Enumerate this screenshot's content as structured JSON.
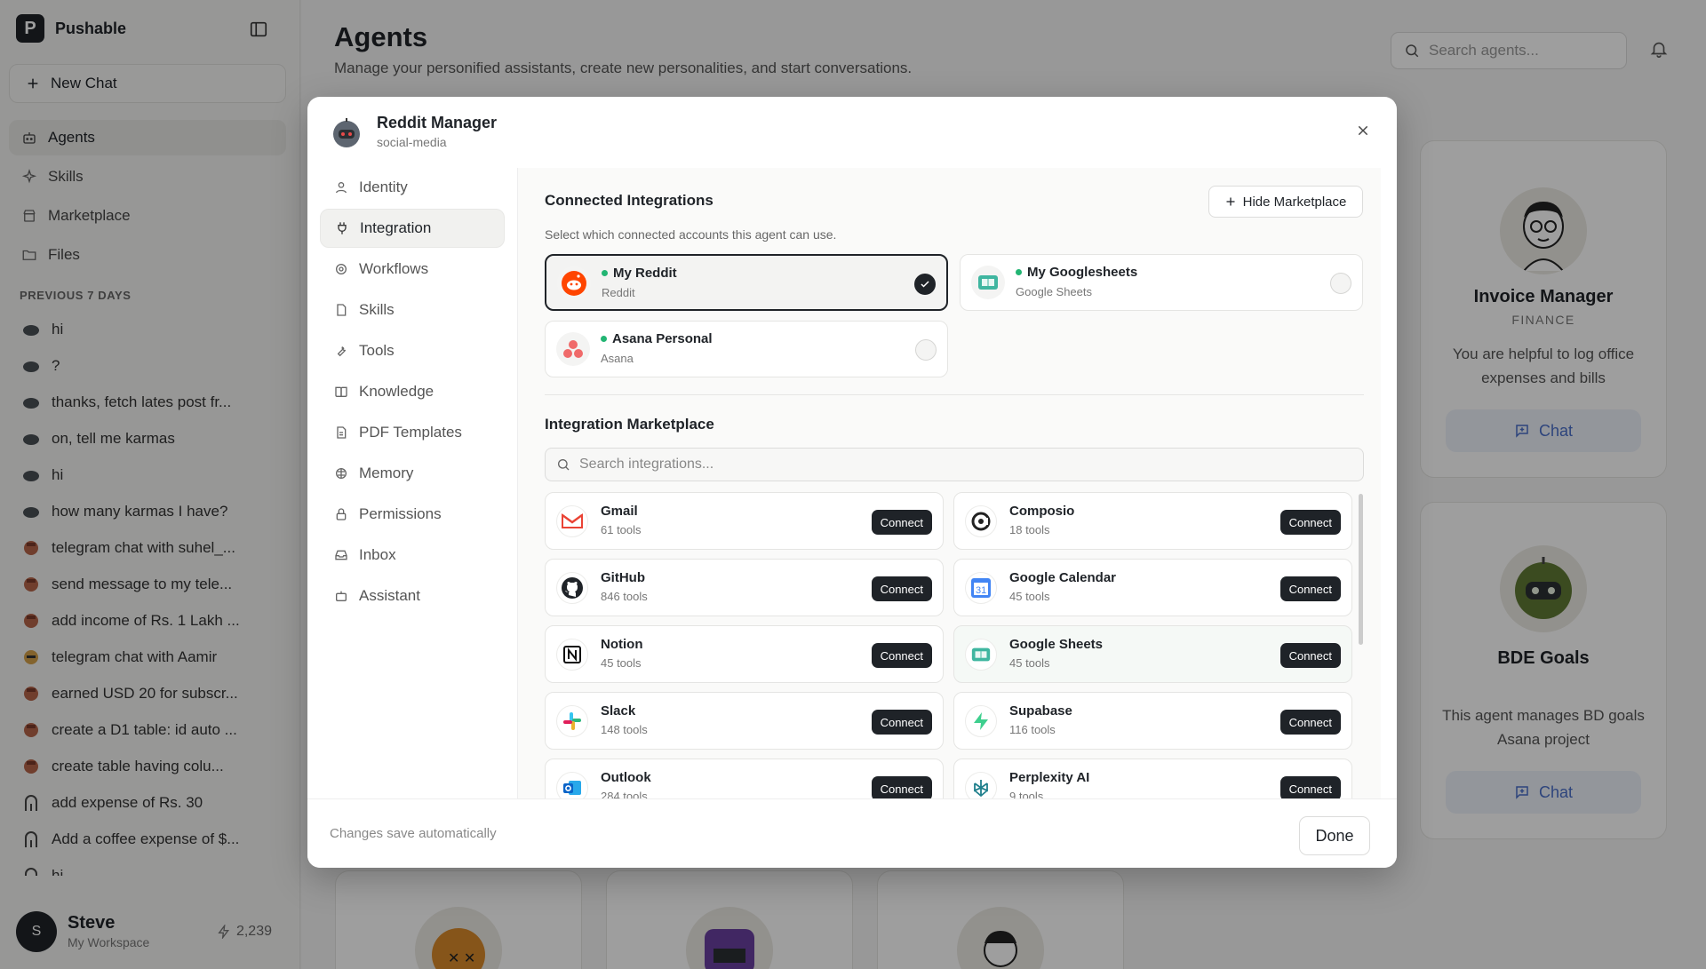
{
  "app": {
    "name": "Pushable"
  },
  "sidebar": {
    "new_chat": "New Chat",
    "nav": [
      {
        "label": "Agents",
        "icon": "bot-icon"
      },
      {
        "label": "Skills",
        "icon": "sparkles-icon"
      },
      {
        "label": "Marketplace",
        "icon": "store-icon"
      },
      {
        "label": "Files",
        "icon": "folder-icon"
      }
    ],
    "section": "PREVIOUS 7 DAYS",
    "history": [
      {
        "label": "hi",
        "icon": "cloud-avatar"
      },
      {
        "label": "?",
        "icon": "cloud-avatar"
      },
      {
        "label": "thanks, fetch lates post fr...",
        "icon": "cloud-avatar"
      },
      {
        "label": "on, tell me karmas",
        "icon": "cloud-avatar"
      },
      {
        "label": "hi",
        "icon": "cloud-avatar"
      },
      {
        "label": "how many karmas I have?",
        "icon": "cloud-avatar"
      },
      {
        "label": "telegram chat with suhel_...",
        "icon": "character-avatar"
      },
      {
        "label": "send message to my tele...",
        "icon": "character-avatar"
      },
      {
        "label": "add income of Rs. 1 Lakh ...",
        "icon": "character-avatar"
      },
      {
        "label": "telegram chat with Aamir",
        "icon": "face-avatar"
      },
      {
        "label": "earned USD 20 for subscr...",
        "icon": "character-avatar"
      },
      {
        "label": "create a D1 table: id auto ...",
        "icon": "character-avatar"
      },
      {
        "label": "create table having colu...",
        "icon": "character-avatar"
      },
      {
        "label": "add expense of Rs. 30",
        "icon": "arch-avatar"
      },
      {
        "label": "Add a coffee expense of $...",
        "icon": "arch-avatar"
      },
      {
        "label": "hi",
        "icon": "arch-avatar"
      }
    ],
    "user": {
      "initial": "S",
      "name": "Steve",
      "workspace": "My Workspace",
      "credits": "2,239"
    }
  },
  "main": {
    "title": "Agents",
    "subtitle": "Manage your personified assistants, create new personalities, and start conversations.",
    "search_placeholder": "Search agents...",
    "cards": [
      {
        "name": "Invoice Manager",
        "category": "FINANCE",
        "description": "You are helpful to log office expenses and bills",
        "chat": "Chat"
      },
      {
        "name": "BDE Goals",
        "category": "",
        "description": "This agent manages BD goals Asana project",
        "chat": "Chat"
      }
    ]
  },
  "modal": {
    "agent_name": "Reddit Manager",
    "agent_slug": "social-media",
    "nav": [
      {
        "label": "Identity",
        "icon": "user-icon"
      },
      {
        "label": "Integration",
        "icon": "plug-icon"
      },
      {
        "label": "Workflows",
        "icon": "cog-icon"
      },
      {
        "label": "Skills",
        "icon": "file-icon"
      },
      {
        "label": "Tools",
        "icon": "wrench-icon"
      },
      {
        "label": "Knowledge",
        "icon": "book-icon"
      },
      {
        "label": "PDF Templates",
        "icon": "document-icon"
      },
      {
        "label": "Memory",
        "icon": "brain-icon"
      },
      {
        "label": "Permissions",
        "icon": "lock-icon"
      },
      {
        "label": "Inbox",
        "icon": "inbox-icon"
      },
      {
        "label": "Assistant",
        "icon": "bot-icon"
      }
    ],
    "connected": {
      "title": "Connected Integrations",
      "hide_button": "Hide Marketplace",
      "description": "Select which connected accounts this agent can use.",
      "items": [
        {
          "name": "My Reddit",
          "provider": "Reddit",
          "selected": true,
          "icon": "reddit-icon"
        },
        {
          "name": "My Googlesheets",
          "provider": "Google Sheets",
          "selected": false,
          "icon": "google-sheets-icon"
        },
        {
          "name": "Asana Personal",
          "provider": "Asana",
          "selected": false,
          "icon": "asana-icon"
        }
      ]
    },
    "marketplace": {
      "title": "Integration Marketplace",
      "search_placeholder": "Search integrations...",
      "connect_label": "Connect",
      "items": [
        {
          "name": "Gmail",
          "tools": "61 tools",
          "icon": "gmail-icon"
        },
        {
          "name": "Composio",
          "tools": "18 tools",
          "icon": "composio-icon"
        },
        {
          "name": "GitHub",
          "tools": "846 tools",
          "icon": "github-icon"
        },
        {
          "name": "Google Calendar",
          "tools": "45 tools",
          "icon": "google-calendar-icon"
        },
        {
          "name": "Notion",
          "tools": "45 tools",
          "icon": "notion-icon"
        },
        {
          "name": "Google Sheets",
          "tools": "45 tools",
          "icon": "google-sheets-icon"
        },
        {
          "name": "Slack",
          "tools": "148 tools",
          "icon": "slack-icon"
        },
        {
          "name": "Supabase",
          "tools": "116 tools",
          "icon": "supabase-icon"
        },
        {
          "name": "Outlook",
          "tools": "284 tools",
          "icon": "outlook-icon"
        },
        {
          "name": "Perplexity AI",
          "tools": "9 tools",
          "icon": "perplexity-icon"
        }
      ]
    },
    "footer": {
      "note": "Changes save automatically",
      "done": "Done"
    }
  },
  "colors": {
    "accent": "#1f2328",
    "online_dot": "#22b573",
    "chat_button": "#4a6fc9"
  }
}
